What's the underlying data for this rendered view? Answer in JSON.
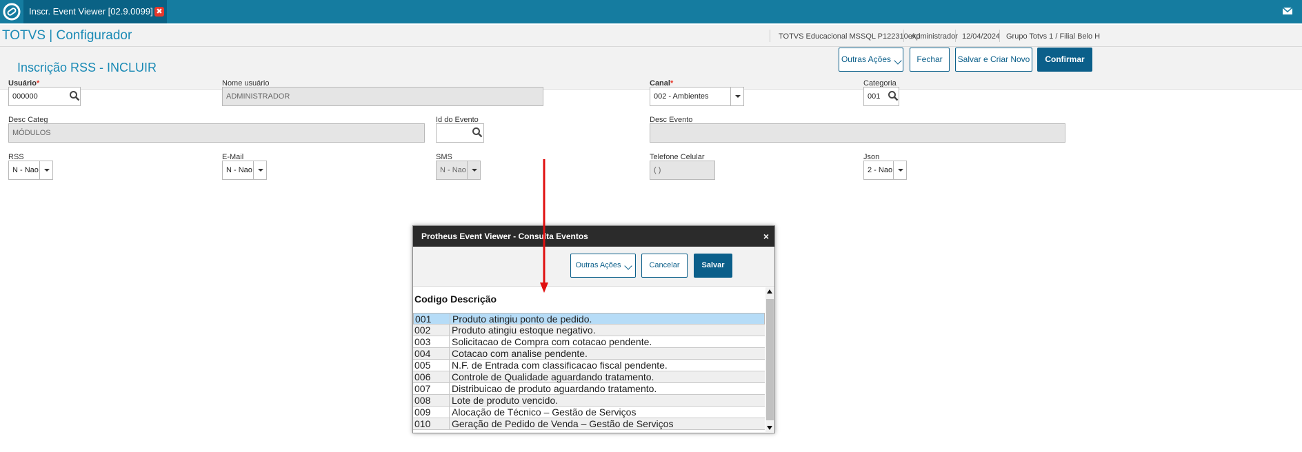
{
  "tabbar": {
    "tab_title": "Inscr. Event Viewer [02.9.0099]",
    "close_glyph": "✖"
  },
  "header": {
    "app_title": "TOTVS | Configurador",
    "environment": "TOTVS Educacional MSSQL P122310exp",
    "user": "Administrador",
    "date": "12/04/2024",
    "branch": "Grupo Totvs 1 / Filial Belo H"
  },
  "page": {
    "title": "Inscrição RSS - INCLUIR",
    "buttons": {
      "other_actions": "Outras Ações",
      "close": "Fechar",
      "save_new": "Salvar e Criar Novo",
      "confirm": "Confirmar"
    }
  },
  "form": {
    "usuario": {
      "label": "Usuário",
      "required": "*",
      "value": "000000"
    },
    "nome_usuario": {
      "label": "Nome usuário",
      "value": "ADMINISTRADOR"
    },
    "canal": {
      "label": "Canal",
      "required": "*",
      "value": "002 - Ambientes"
    },
    "categoria": {
      "label": "Categoria",
      "value": "001"
    },
    "desc_categ": {
      "label": "Desc Categ",
      "value": "MÓDULOS"
    },
    "id_evento": {
      "label": "Id do Evento",
      "value": ""
    },
    "desc_evento": {
      "label": "Desc Evento",
      "value": ""
    },
    "rss": {
      "label": "RSS",
      "value": "N - Nao"
    },
    "email": {
      "label": "E-Mail",
      "value": "N - Nao"
    },
    "sms": {
      "label": "SMS",
      "value": "N - Nao"
    },
    "telefone": {
      "label": "Telefone Celular",
      "value": "( )"
    },
    "json": {
      "label": "Json",
      "value": "2 - Nao"
    }
  },
  "modal": {
    "title": "Protheus Event Viewer - Consulta Eventos",
    "close_glyph": "×",
    "buttons": {
      "other_actions": "Outras Ações",
      "cancel": "Cancelar",
      "save": "Salvar"
    },
    "columns": {
      "code": "Codigo",
      "desc": "Descrição"
    },
    "rows": [
      {
        "code": "001",
        "desc": "Produto atingiu ponto de pedido."
      },
      {
        "code": "002",
        "desc": "Produto atingiu estoque negativo."
      },
      {
        "code": "003",
        "desc": "Solicitacao de Compra com cotacao pendente."
      },
      {
        "code": "004",
        "desc": "Cotacao com analise pendente."
      },
      {
        "code": "005",
        "desc": "N.F. de Entrada com classificacao fiscal pendente."
      },
      {
        "code": "006",
        "desc": "Controle de Qualidade aguardando tratamento."
      },
      {
        "code": "007",
        "desc": "Distribuicao de produto aguardando tratamento."
      },
      {
        "code": "008",
        "desc": "Lote de produto vencido."
      },
      {
        "code": "009",
        "desc": "Alocação de Técnico – Gestão de Serviços"
      },
      {
        "code": "010",
        "desc": "Geração de Pedido de Venda – Gestão de Serviços"
      }
    ],
    "selected_row": 0
  },
  "icons": {
    "logo": "totvs-logo-icon",
    "mail": "mail-icon",
    "search": "search-icon",
    "dropdown": "chevron-down-icon"
  },
  "colors": {
    "topbar": "#157ca0",
    "accent": "#1a8ab5",
    "primary_button": "#0b5f8a",
    "required": "#e8382b",
    "annotation_arrow": "#e01010",
    "selection": "#b6dcf7"
  }
}
